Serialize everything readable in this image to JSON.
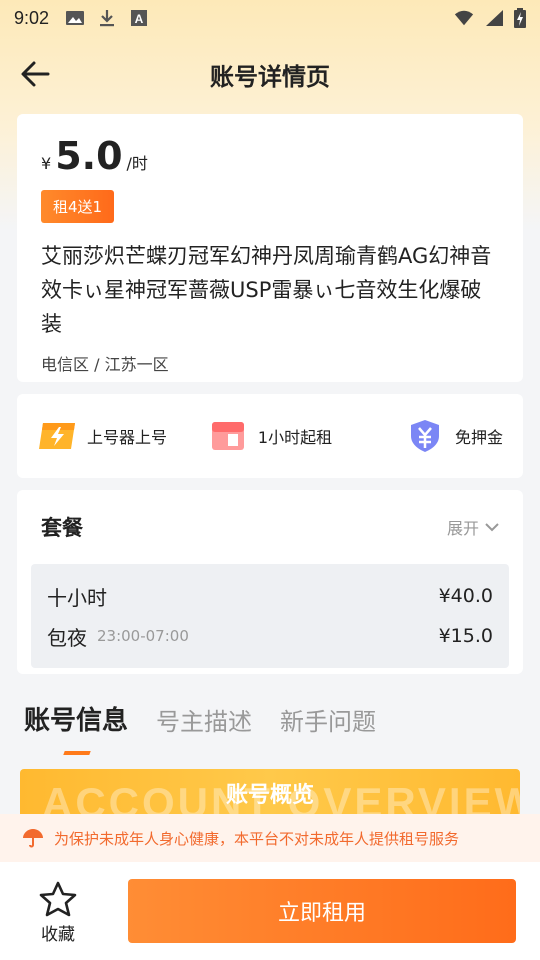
{
  "status_bar": {
    "time": "9:02",
    "left_icons": [
      "image-icon",
      "download-icon",
      "font-icon"
    ],
    "right_icons": [
      "wifi-icon",
      "signal-icon",
      "battery-charging-icon"
    ]
  },
  "nav": {
    "title": "账号详情页",
    "back_icon": "arrow-left-icon"
  },
  "listing": {
    "price_symbol": "¥",
    "price": "5.0",
    "price_unit": "/时",
    "promo": "租4送1",
    "title": "艾丽莎炽芒蝶刃冠军幻神丹凤周瑜青鹤AG幻神音效卡ぃ星神冠军蔷薇USP雷暴ぃ七音效生化爆破装",
    "region": "电信区 / 江苏一区"
  },
  "features": [
    {
      "icon": "lightning-card-icon",
      "label": "上号器上号"
    },
    {
      "icon": "shop-icon",
      "label": "1小时起租"
    },
    {
      "icon": "yuan-shield-icon",
      "label": "免押金"
    }
  ],
  "package": {
    "title": "套餐",
    "expand_label": "展开",
    "items": [
      {
        "name": "十小时",
        "time": "",
        "price": "¥40.0"
      },
      {
        "name": "包夜",
        "time": "23:00-07:00",
        "price": "¥15.0"
      }
    ]
  },
  "tabs": [
    {
      "label": "账号信息",
      "active": true
    },
    {
      "label": "号主描述",
      "active": false
    },
    {
      "label": "新手问题",
      "active": false
    }
  ],
  "overview": {
    "title": "账号概览",
    "bg_text": "ACCOUNT OVERVIEW"
  },
  "notice": {
    "text": "为保护未成年人身心健康，本平台不对未成年人提供租号服务"
  },
  "bottom": {
    "favorite_label": "收藏",
    "rent_label": "立即租用"
  },
  "colors": {
    "accent": "#ff7a1a",
    "notice_text": "#f26a2e",
    "banner": "#ffb930"
  }
}
